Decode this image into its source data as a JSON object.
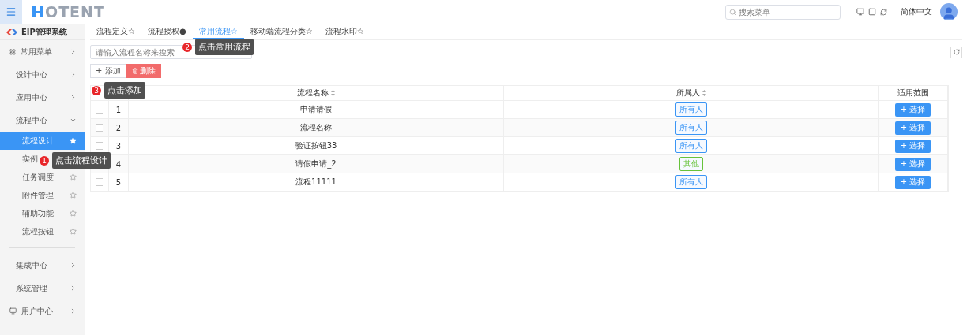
{
  "header": {
    "logo": "OTENT",
    "search": {
      "placeholder": "搜索菜单"
    },
    "language": "简体中文"
  },
  "sidebar": {
    "system": "EIP管理系统",
    "items": [
      {
        "label": "常用菜单",
        "kind": "group",
        "expanded": false
      },
      {
        "label": "设计中心",
        "kind": "group",
        "expanded": false
      },
      {
        "label": "应用中心",
        "kind": "group",
        "expanded": false
      },
      {
        "label": "流程中心",
        "kind": "group",
        "expanded": true,
        "children": [
          {
            "label": "流程设计",
            "selected": true,
            "starred": true
          },
          {
            "label": "实例",
            "selected": false
          },
          {
            "label": "任务调度",
            "selected": false,
            "starred": false
          },
          {
            "label": "附件管理",
            "selected": false,
            "starred": false
          },
          {
            "label": "辅助功能",
            "selected": false,
            "starred": false
          },
          {
            "label": "流程按钮",
            "selected": false,
            "starred": false
          }
        ]
      },
      {
        "label": "集成中心",
        "kind": "group",
        "expanded": false
      },
      {
        "label": "系统管理",
        "kind": "group",
        "expanded": false
      },
      {
        "label": "用户中心",
        "kind": "user",
        "expanded": false
      }
    ]
  },
  "tabs": [
    {
      "label": "流程定义☆",
      "selected": false
    },
    {
      "label": "流程授权●",
      "selected": false
    },
    {
      "label": "常用流程☆",
      "selected": true
    },
    {
      "label": "移动端流程分类☆",
      "selected": false
    },
    {
      "label": "流程水印☆",
      "selected": false
    }
  ],
  "search": {
    "placeholder": "请输入流程名称来搜索"
  },
  "actions": [
    {
      "label": "+ 添加",
      "kind": "default"
    },
    {
      "label": "删除",
      "kind": "danger"
    }
  ],
  "table": {
    "columns": [
      "流程名称",
      "所属人",
      "适用范围"
    ],
    "rows": [
      {
        "checked": false,
        "index": "1",
        "name": "申请请假",
        "owner": "所有人",
        "color": "#3a95f5",
        "action": "+ 选择"
      },
      {
        "checked": false,
        "index": "2",
        "name": "流程名称",
        "owner": "所有人",
        "color": "#3a95f5",
        "action": "+ 选择"
      },
      {
        "checked": false,
        "index": "3",
        "name": "验证按钮33",
        "owner": "所有人",
        "color": "#3a95f5",
        "action": "+ 选择"
      },
      {
        "index": "4",
        "name": "请假申请_2",
        "owner": "其他",
        "color": "#67c23a",
        "action": "+ 选择"
      },
      {
        "checked": false,
        "index": "5",
        "name": "流程11111",
        "owner": "所有人",
        "color": "#3a95f5",
        "action": "+ 选择"
      }
    ]
  },
  "tooltips": [
    {
      "number": "1",
      "text": "点击流程设计"
    },
    {
      "number": "2",
      "text": "点击常用流程"
    },
    {
      "number": "3",
      "text": "点击添加"
    }
  ]
}
